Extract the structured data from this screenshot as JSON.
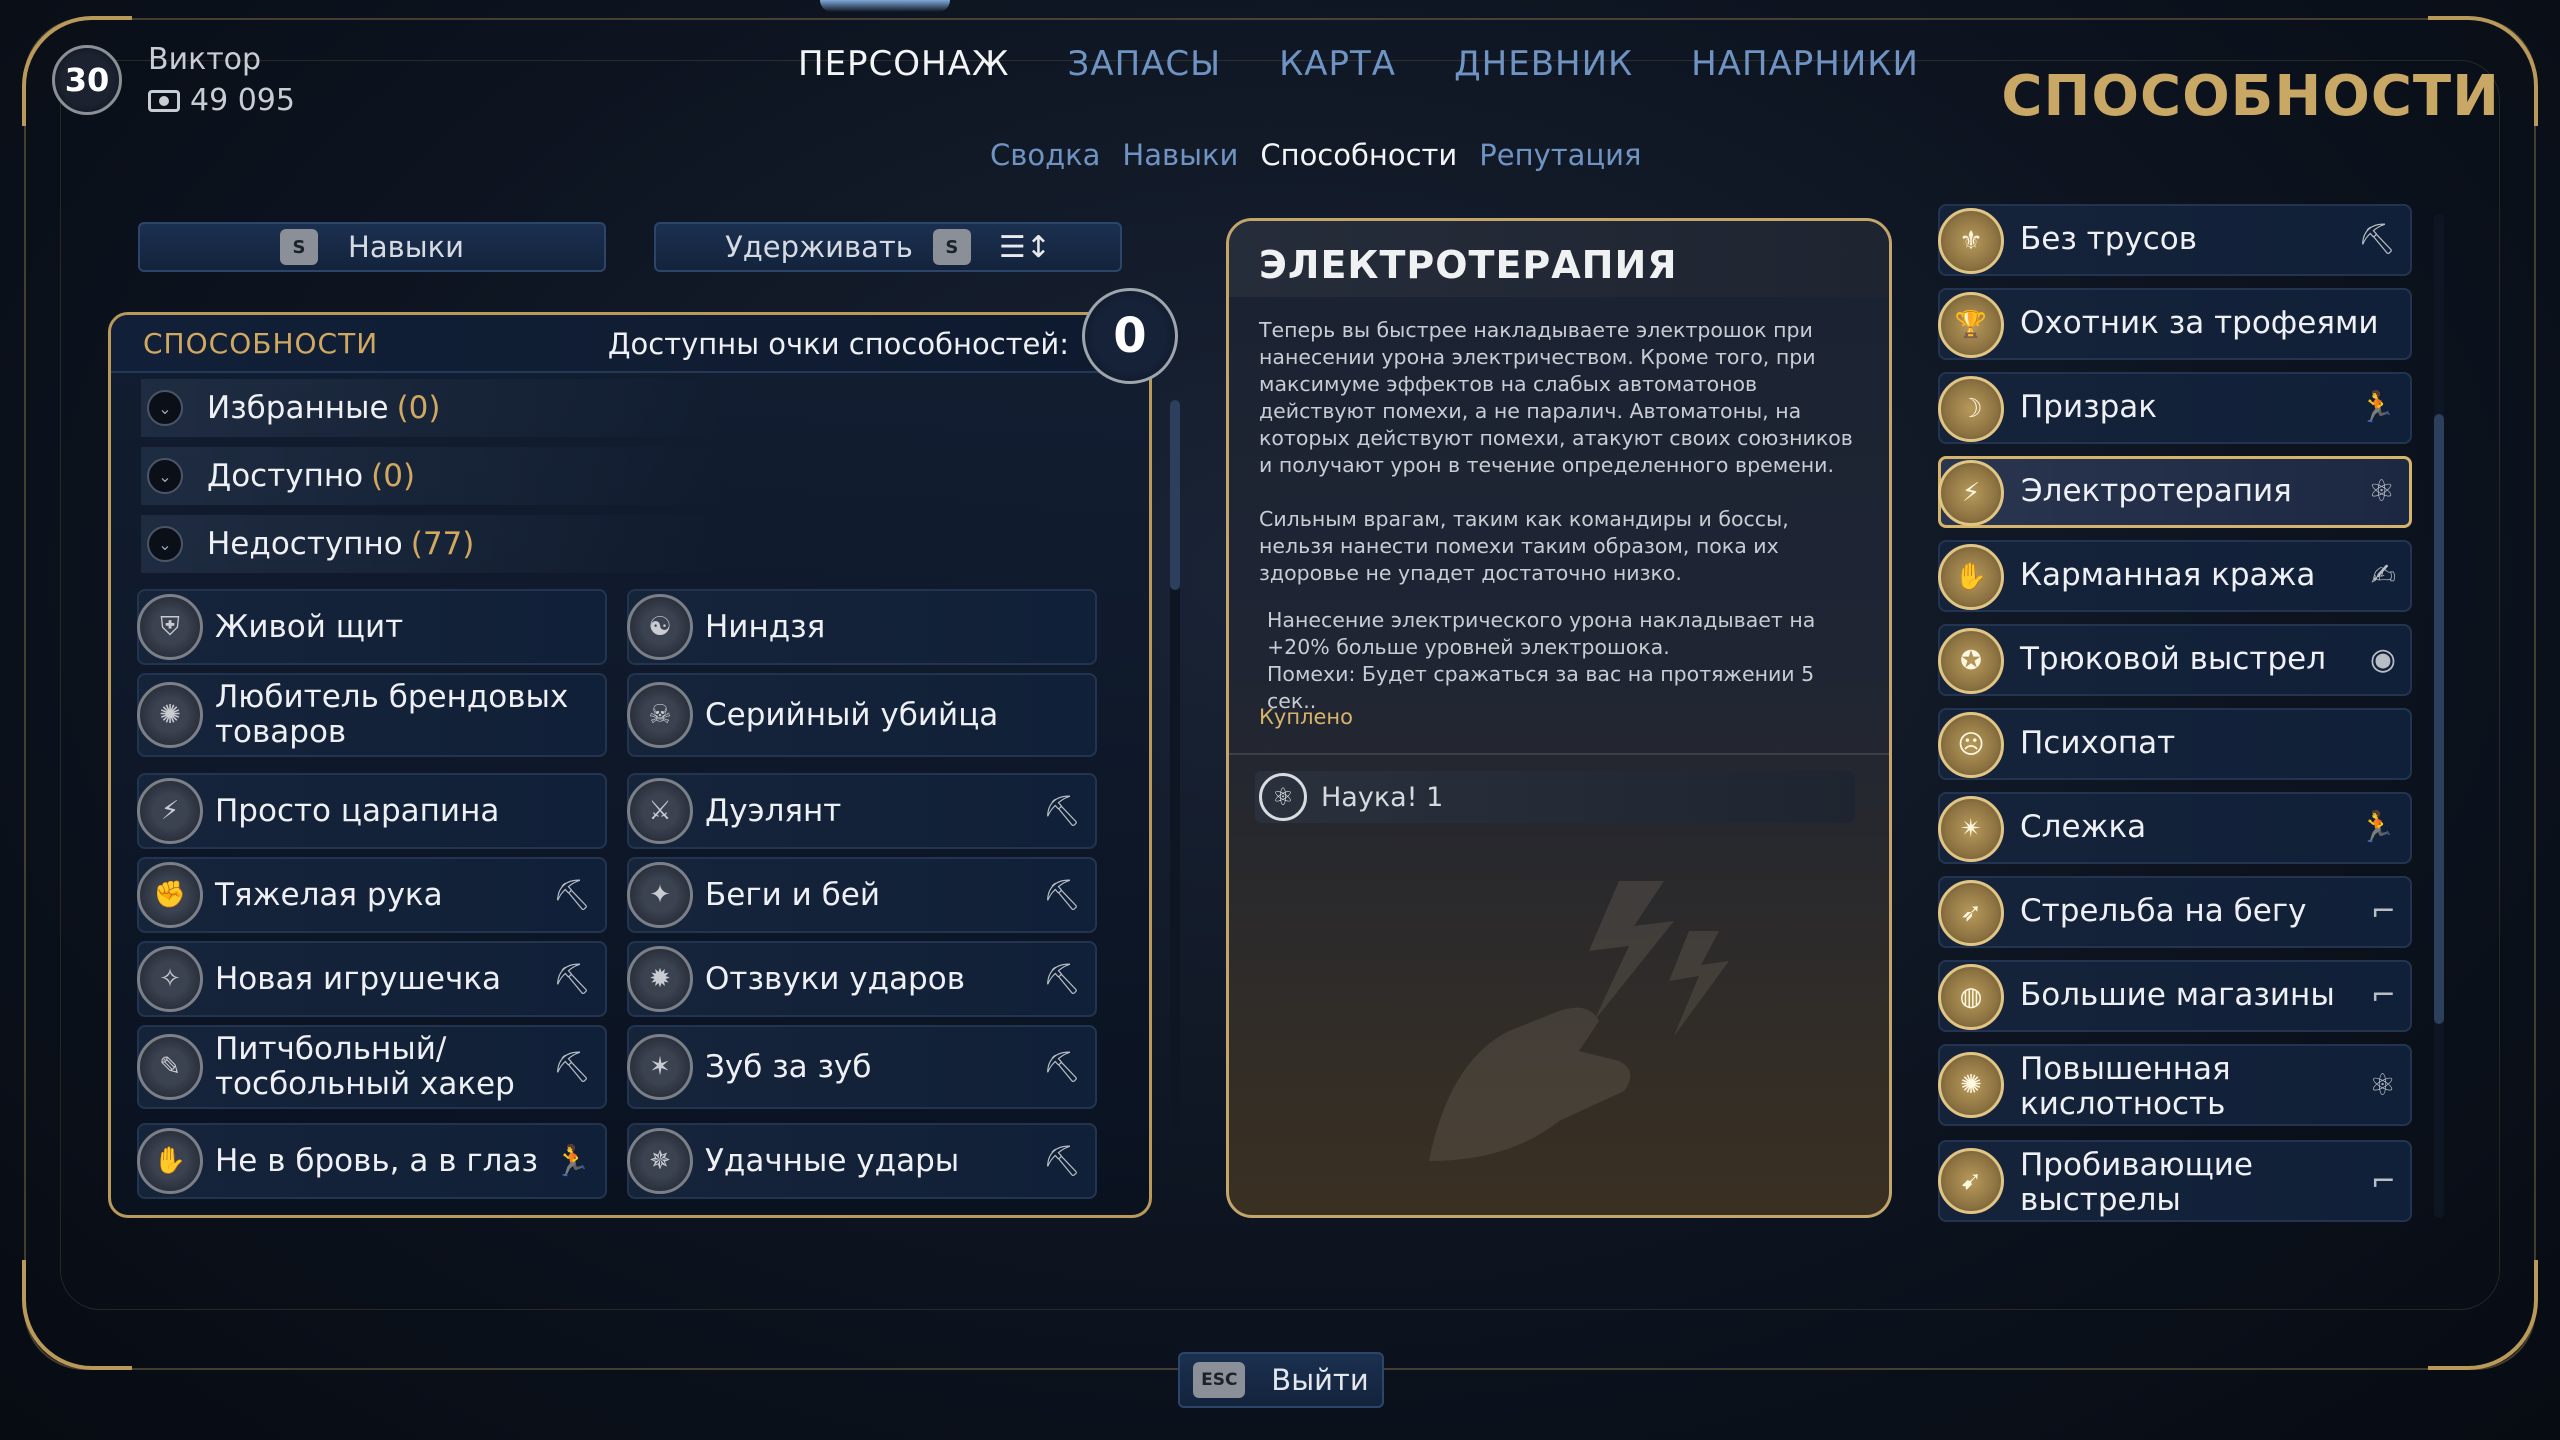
{
  "player": {
    "level": "30",
    "name": "Виктор",
    "money": "49 095"
  },
  "nav": {
    "main_tabs": [
      "ПЕРСОНАЖ",
      "ЗАПАСЫ",
      "КАРТА",
      "ДНЕВНИК",
      "НАПАРНИКИ"
    ],
    "active_main": "ПЕРСОНАЖ",
    "sub_tabs": [
      "Сводка",
      "Навыки",
      "Способности",
      "Репутация"
    ],
    "active_sub": "Способности"
  },
  "page_title": "СПОСОБНОСТИ",
  "controls": {
    "skills_key": "S",
    "skills_label": "Навыки",
    "hold_label": "Удерживать",
    "hold_key": "S",
    "sort_icon": "sort-icon"
  },
  "left_panel": {
    "title": "СПОСОБНОСТИ",
    "points_label": "Доступны очки способностей:",
    "points_value": "0",
    "categories": [
      {
        "label": "Избранные",
        "count": "(0)"
      },
      {
        "label": "Доступно",
        "count": "(0)"
      },
      {
        "label": "Недоступно",
        "count": "(77)"
      }
    ],
    "skills": [
      {
        "name": "Живой щит",
        "icon": "shield-person-icon",
        "tag": ""
      },
      {
        "name": "Ниндзя",
        "icon": "ninja-icon",
        "tag": ""
      },
      {
        "name": "Любитель брендовых товаров",
        "icon": "brand-icon",
        "tag": ""
      },
      {
        "name": "Серийный убийца",
        "icon": "serial-killer-icon",
        "tag": ""
      },
      {
        "name": "Просто царапина",
        "icon": "scratch-icon",
        "tag": ""
      },
      {
        "name": "Дуэлянт",
        "icon": "duelist-icon",
        "tag": "pickaxe-icon"
      },
      {
        "name": "Тяжелая рука",
        "icon": "heavy-hand-icon",
        "tag": "pickaxe-icon"
      },
      {
        "name": "Беги и бей",
        "icon": "run-hit-icon",
        "tag": "pickaxe-icon"
      },
      {
        "name": "Новая игрушечка",
        "icon": "new-toy-icon",
        "tag": "pickaxe-icon"
      },
      {
        "name": "Отзвуки ударов",
        "icon": "echo-icon",
        "tag": "pickaxe-icon"
      },
      {
        "name": "Питчбольный/ тосбольный хакер",
        "icon": "hacker-icon",
        "tag": "pickaxe-icon"
      },
      {
        "name": "Зуб за зуб",
        "icon": "tooth-icon",
        "tag": "pickaxe-icon"
      },
      {
        "name": "Не в бровь, а в глаз",
        "icon": "eye-hit-icon",
        "tag": "runner-icon"
      },
      {
        "name": "Удачные удары",
        "icon": "lucky-hit-icon",
        "tag": "pickaxe-icon"
      }
    ]
  },
  "detail": {
    "title": "ЭЛЕКТРОТЕРАПИЯ",
    "desc1": "Теперь вы быстрее накладываете электрошок при нанесении урона электричеством. Кроме того, при максимуме эффектов на слабых автоматонов действуют помехи, а не паралич. Автоматоны, на которых действуют помехи, атакуют своих союзников и получают урон в течение определенного времени.",
    "desc2": "Сильным врагам, таким как командиры и боссы, нельзя нанести помехи таким образом, пока их здоровье не упадет достаточно низко.",
    "effect1": "Нанесение электрического урона накладывает на +20% больше уровней электрошока.",
    "effect2": "Помехи: Будет сражаться за вас на протяжении 5 сек..",
    "status": "Куплено",
    "requirement": "Наука! 1",
    "requirement_icon": "atom-icon"
  },
  "right_list": [
    {
      "name": "Без трусов",
      "icon": "underwear-icon",
      "tag": "pickaxe-icon",
      "selected": false
    },
    {
      "name": "Охотник за трофеями",
      "icon": "trophy-icon",
      "tag": "",
      "selected": false
    },
    {
      "name": "Призрак",
      "icon": "ghost-icon",
      "tag": "runner-icon",
      "selected": false
    },
    {
      "name": "Электротерапия",
      "icon": "electro-icon",
      "tag": "atom-icon",
      "selected": true
    },
    {
      "name": "Карманная кража",
      "icon": "pickpocket-icon",
      "tag": "hand-icon",
      "selected": false
    },
    {
      "name": "Трюковой выстрел",
      "icon": "trick-shot-icon",
      "tag": "eye-icon",
      "selected": false
    },
    {
      "name": "Психопат",
      "icon": "psycho-icon",
      "tag": "",
      "selected": false
    },
    {
      "name": "Слежка",
      "icon": "spy-icon",
      "tag": "runner-icon",
      "selected": false
    },
    {
      "name": "Стрельба на бегу",
      "icon": "run-shoot-icon",
      "tag": "gun-icon",
      "selected": false
    },
    {
      "name": "Большие магазины",
      "icon": "magazine-icon",
      "tag": "gun-icon",
      "selected": false
    },
    {
      "name": "Повышенная кислотность",
      "icon": "acid-icon",
      "tag": "atom-icon",
      "selected": false
    },
    {
      "name": "Пробивающие выстрелы",
      "icon": "pierce-icon",
      "tag": "gun-icon",
      "selected": false
    }
  ],
  "exit": {
    "key": "ESC",
    "label": "Выйти"
  },
  "colors": {
    "gold": "#c9a866",
    "accent_blue": "#6f93c2",
    "frame": "#b99a5a"
  }
}
